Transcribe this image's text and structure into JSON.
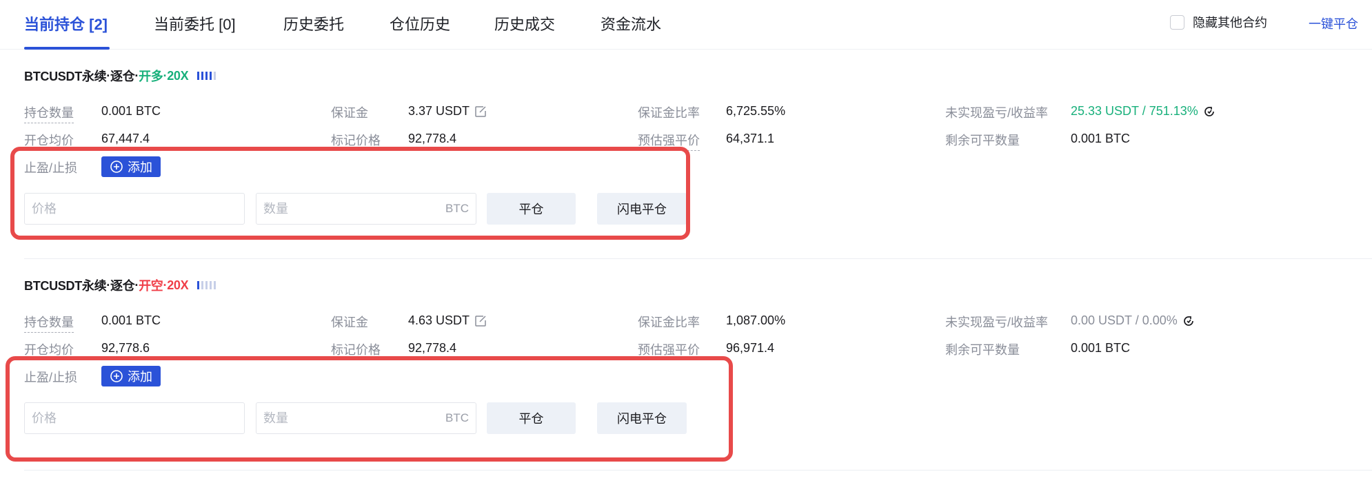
{
  "tabs": [
    {
      "label": "当前持仓 [2]",
      "active": true
    },
    {
      "label": "当前委托 [0]",
      "active": false
    },
    {
      "label": "历史委托",
      "active": false
    },
    {
      "label": "仓位历史",
      "active": false
    },
    {
      "label": "历史成交",
      "active": false
    },
    {
      "label": "资金流水",
      "active": false
    }
  ],
  "toolbar": {
    "hide_other_label": "隐藏其他合约",
    "hide_other_checked": false,
    "close_all_label": "一键平仓"
  },
  "colors": {
    "accent": "#2b52d8",
    "long": "#18b07b",
    "short": "#f03e48",
    "highlight": "#e84a4a"
  },
  "positions": [
    {
      "symbol": "BTCUSDT永续",
      "margin_mode": "逐仓",
      "side": "开多",
      "side_type": "long",
      "leverage": "20X",
      "risk_level": 4,
      "risk_level_max": 5,
      "fields": {
        "size_label": "持仓数量",
        "size_value": "0.001 BTC",
        "entry_label": "开仓均价",
        "entry_value": "67,447.4",
        "margin_label": "保证金",
        "margin_value": "3.37 USDT",
        "mark_label": "标记价格",
        "mark_value": "92,778.4",
        "margin_ratio_label": "保证金比率",
        "margin_ratio_value": "6,725.55%",
        "liq_label": "预估强平价",
        "liq_value": "64,371.1",
        "pnl_label": "未实现盈亏/收益率",
        "pnl_value": "25.33 USDT / 751.13%",
        "closable_label": "剩余可平数量",
        "closable_value": "0.001 BTC"
      },
      "tpsl_label": "止盈/止损",
      "add_label": "添加",
      "price_placeholder": "价格",
      "qty_placeholder": "数量",
      "qty_unit": "BTC",
      "close_label": "平仓",
      "flash_close_label": "闪电平仓"
    },
    {
      "symbol": "BTCUSDT永续",
      "margin_mode": "逐仓",
      "side": "开空",
      "side_type": "short",
      "leverage": "20X",
      "risk_level": 1,
      "risk_level_max": 5,
      "fields": {
        "size_label": "持仓数量",
        "size_value": "0.001 BTC",
        "entry_label": "开仓均价",
        "entry_value": "92,778.6",
        "margin_label": "保证金",
        "margin_value": "4.63 USDT",
        "mark_label": "标记价格",
        "mark_value": "92,778.4",
        "margin_ratio_label": "保证金比率",
        "margin_ratio_value": "1,087.00%",
        "liq_label": "预估强平价",
        "liq_value": "96,971.4",
        "pnl_label": "未实现盈亏/收益率",
        "pnl_value": "0.00 USDT / 0.00%",
        "closable_label": "剩余可平数量",
        "closable_value": "0.001 BTC"
      },
      "tpsl_label": "止盈/止损",
      "add_label": "添加",
      "price_placeholder": "价格",
      "qty_placeholder": "数量",
      "qty_unit": "BTC",
      "close_label": "平仓",
      "flash_close_label": "闪电平仓"
    }
  ]
}
